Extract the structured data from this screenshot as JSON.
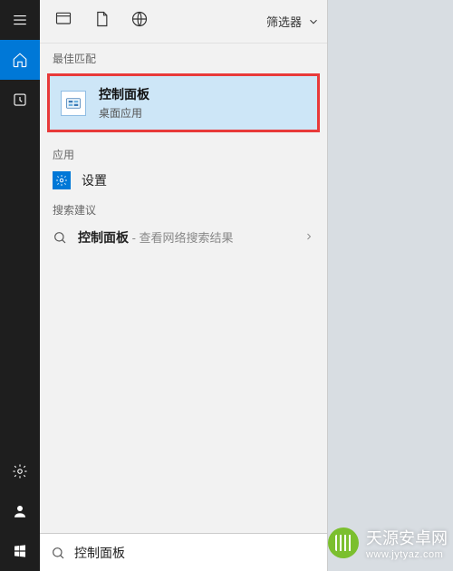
{
  "rail": {
    "items": [
      "menu",
      "home",
      "recent",
      "settings",
      "account",
      "start"
    ]
  },
  "scope": {
    "filter_label": "筛选器"
  },
  "sections": {
    "best_match_caption": "最佳匹配",
    "apps_caption": "应用",
    "web_caption": "搜索建议"
  },
  "best_match": {
    "title": "控制面板",
    "subtitle": "桌面应用"
  },
  "settings_item": {
    "label": "设置"
  },
  "web_suggestion": {
    "term": "控制面板",
    "hint": " - 查看网络搜索结果"
  },
  "search": {
    "value": "控制面板",
    "placeholder": ""
  },
  "watermark": {
    "line1": "天源安卓网",
    "line2": "www.jytyaz.com"
  }
}
